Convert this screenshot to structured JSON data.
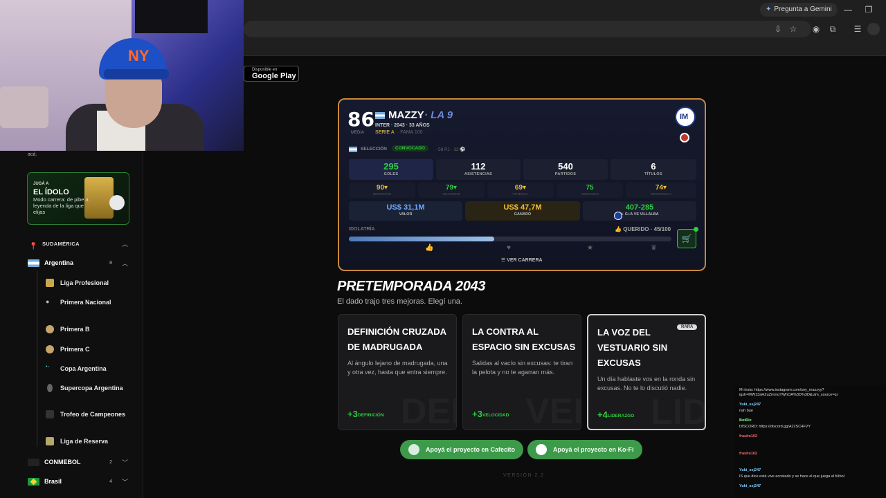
{
  "browser": {
    "gemini_label": "Pregunta a Gemini"
  },
  "store_badge": {
    "small": "Disponible en",
    "big": "Google Play"
  },
  "sidebar": {
    "aca_text": "acá.",
    "idolo": {
      "kicker": "JUGÁ A",
      "title": "EL ÍDOLO",
      "desc": "Modo carrera: de pibe a leyenda de la liga que elijas"
    },
    "region_label": "SUDAMÉRICA",
    "argentina": {
      "name": "Argentina",
      "count": "8"
    },
    "leagues": [
      "Liga Profesional",
      "Primera Nacional",
      "Primera B",
      "Primera C",
      "Copa Argentina",
      "Supercopa Argentina",
      "Trofeo de Campeones",
      "Liga de Reserva"
    ],
    "conmebol": {
      "name": "CONMEBOL",
      "count": "2"
    },
    "brasil": {
      "name": "Brasil",
      "count": "4"
    }
  },
  "player": {
    "overall": "86",
    "media_label": "MEDIA",
    "name": "MAZZY",
    "nickname": "· LA 9",
    "team_line": "INTER · 2043 · 33 AÑOS",
    "league": "SERIE A",
    "fame": "· FAMA 100",
    "selection_label": "SELECCIÓN",
    "convocado": "CONVOCADO",
    "selection_stats": "· 58 PJ · 32 ⚽",
    "stats": [
      {
        "value": "295",
        "label": "GOLES",
        "color": "#2ecc40"
      },
      {
        "value": "112",
        "label": "ASISTENCIAS",
        "color": "#ffffff"
      },
      {
        "value": "540",
        "label": "PARTIDOS",
        "color": "#ffffff"
      },
      {
        "value": "6",
        "label": "TÍTULOS",
        "color": "#ffffff"
      }
    ],
    "attributes": [
      {
        "value": "90▾",
        "label": "DEFINICIÓN",
        "color": "#f0c030"
      },
      {
        "value": "79▾",
        "label": "VELOCIDAD",
        "color": "#2ecc40"
      },
      {
        "value": "69▾",
        "label": "POTENCIA",
        "color": "#f0c030"
      },
      {
        "value": "75",
        "label": "LIDERAZGO",
        "color": "#2ecc40"
      },
      {
        "value": "74▾",
        "label": "RESISTENCIA",
        "color": "#f0c030"
      }
    ],
    "money": [
      {
        "value": "US$ 31,1M",
        "label": "VALOR",
        "color": "#6fa8ff"
      },
      {
        "value": "US$ 47,7M",
        "label": "GANADO",
        "color": "#f0c030"
      },
      {
        "value": "407-285",
        "label": "⚔ G+A VS VILLALBA",
        "color": "#2ecc40"
      }
    ],
    "idolatria_label": "IDOLATRÍA",
    "querido": "QUERIDO · 45/100",
    "idolatria_value": 0.45,
    "ver_carrera": "☰ VER CARRERA"
  },
  "preseason": {
    "title": "PRETEMPORADA 2043",
    "subtitle": "El dado trajo tres mejoras. Elegí una.",
    "options": [
      {
        "title": "Definición cruzada de madrugada",
        "desc": "Al ángulo lejano de madrugada, una y otra vez, hasta que entra siempre.",
        "bonus": "+3",
        "stat": "DEFINICIÓN",
        "watermark": "DEF"
      },
      {
        "title": "La contra al espacio sin excusas",
        "desc": "Salidas al vacío sin excusas: te tiran la pelota y no te agarran más.",
        "bonus": "+3",
        "stat": "VELOCIDAD",
        "watermark": "VEL"
      },
      {
        "title": "La voz del vestuario sin excusas",
        "desc": "Un día hablaste vos en la ronda sin excusas. No te lo discutió nadie.",
        "bonus": "+4",
        "stat": "LIDERAZGO",
        "watermark": "LID",
        "badge": "RARA"
      }
    ]
  },
  "support": {
    "cafecito": "Apoyá el proyecto en Cafecito",
    "kofi": "Apoyá el proyecto en Ko-Fi"
  },
  "version": "VERSIÓN 2.2",
  "chat": [
    {
      "user": "",
      "text": "Mi insta: https://www.instagram.com/soy_mazzyy?igsh=MW13aHZuZmmqYWhOA%3D%3D&utm_source=qr",
      "color": "#ddd"
    },
    {
      "user": "Yuki_ssj247",
      "text": "",
      "color": "#7fd3ff"
    },
    {
      "user": "",
      "text": "nah bue",
      "color": "#ddd"
    },
    {
      "user": "BotRix",
      "text": "",
      "color": "#8cff8c"
    },
    {
      "user": "",
      "text": "DISCORD: https://discord.gg/A22SC4FVY",
      "color": "#ddd"
    },
    {
      "user": "frasito102",
      "text": "",
      "color": "#ff6b6b"
    },
    {
      "user": "frasito102",
      "text": "",
      "color": "#ff6b6b"
    },
    {
      "user": "Yuki_ssj247",
      "text": "",
      "color": "#7fd3ff"
    },
    {
      "user": "",
      "text": "IS que dice está vive acostado y se hace el que juega al fútbol",
      "color": "#ddd"
    },
    {
      "user": "Yuki_ssj247",
      "text": "",
      "color": "#7fd3ff"
    }
  ]
}
